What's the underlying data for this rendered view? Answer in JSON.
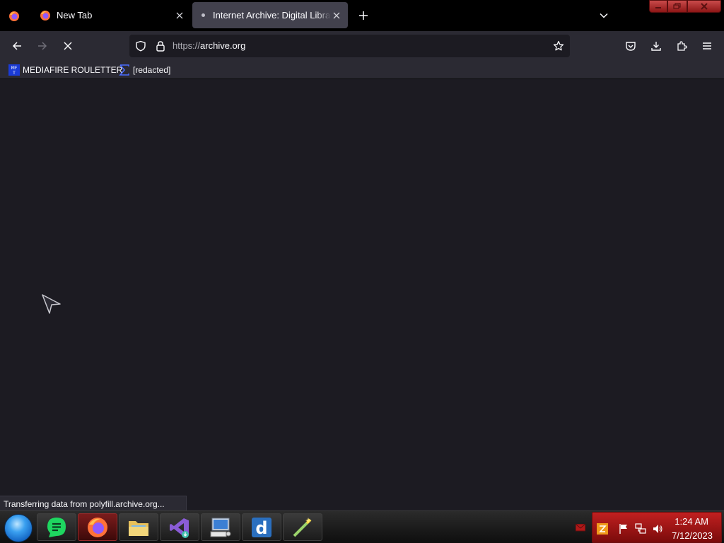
{
  "tabs": [
    {
      "title": "New Tab",
      "active": false
    },
    {
      "title": "Internet Archive: Digital Library",
      "active": true,
      "loading": true
    }
  ],
  "url": {
    "scheme": "https://",
    "host": "archive.org"
  },
  "bookmarks": [
    {
      "label": "MEDIAFIRE ROULETTER",
      "icon": "mft-icon"
    },
    {
      "label": "[redacted]",
      "icon": "sigma-icon"
    }
  ],
  "status": "Transferring data from polyfill.archive.org...",
  "taskbar": {
    "apps": [
      "start-orb",
      "notes-app",
      "firefox",
      "file-explorer",
      "visual-studio-installer",
      "remote-desktop",
      "dictionary-app",
      "tool-app"
    ]
  },
  "clock": {
    "time": "1:24 AM",
    "date": "7/12/2023"
  },
  "colors": {
    "chrome": "#2b2a33",
    "content": "#1c1b22",
    "tabstrip": "#000000",
    "active_tab": "#42414d",
    "tray": "#b01818"
  }
}
